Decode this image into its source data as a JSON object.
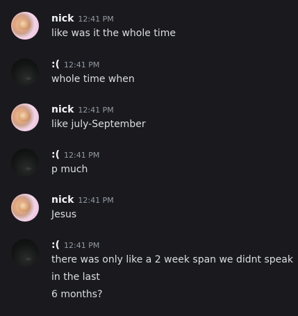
{
  "messages": [
    {
      "author": "nick",
      "time": "12:41 PM",
      "avatar_icon": "dog-photo-avatar",
      "lines": [
        "like was it the whole time"
      ]
    },
    {
      "author": ":(",
      "time": "12:41 PM",
      "avatar_icon": "dark-photo-avatar",
      "lines": [
        "whole time when"
      ]
    },
    {
      "author": "nick",
      "time": "12:41 PM",
      "avatar_icon": "dog-photo-avatar",
      "lines": [
        "like july-September"
      ]
    },
    {
      "author": ":(",
      "time": "12:41 PM",
      "avatar_icon": "dark-photo-avatar",
      "lines": [
        "p much"
      ]
    },
    {
      "author": "nick",
      "time": "12:41 PM",
      "avatar_icon": "dog-photo-avatar",
      "lines": [
        "Jesus"
      ]
    },
    {
      "author": ":(",
      "time": "12:41 PM",
      "avatar_icon": "dark-photo-avatar",
      "lines": [
        "there was only like a 2 week span we didnt speak",
        "in the last",
        "6 months?"
      ]
    }
  ],
  "colors": {
    "background": "#1a1a1e",
    "username": "#f2f3f5",
    "timestamp": "#949ba4",
    "message_text": "#dbdee1"
  }
}
